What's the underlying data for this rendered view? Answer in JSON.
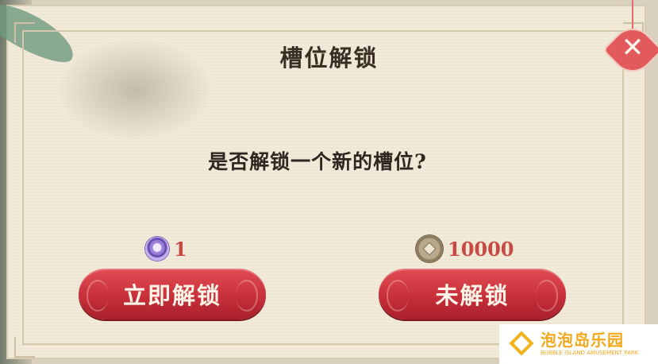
{
  "dialog": {
    "title": "槽位解锁",
    "question": "是否解锁一个新的槽位?",
    "close_label": "✕"
  },
  "costs": {
    "gem": {
      "icon": "purple-gem-icon",
      "value": "1"
    },
    "coin": {
      "icon": "copper-coin-icon",
      "value": "10000"
    }
  },
  "buttons": {
    "unlock_now": "立即解锁",
    "not_unlocked": "未解锁"
  },
  "watermark": {
    "cn": "泡泡岛乐园",
    "en": "BUBBLE ISLAND AMUSEMENT PARK"
  },
  "colors": {
    "button_red": "#c8303a",
    "cost_red": "#c74a44",
    "panel": "#f1ead8",
    "watermark": "#f2a81b"
  }
}
